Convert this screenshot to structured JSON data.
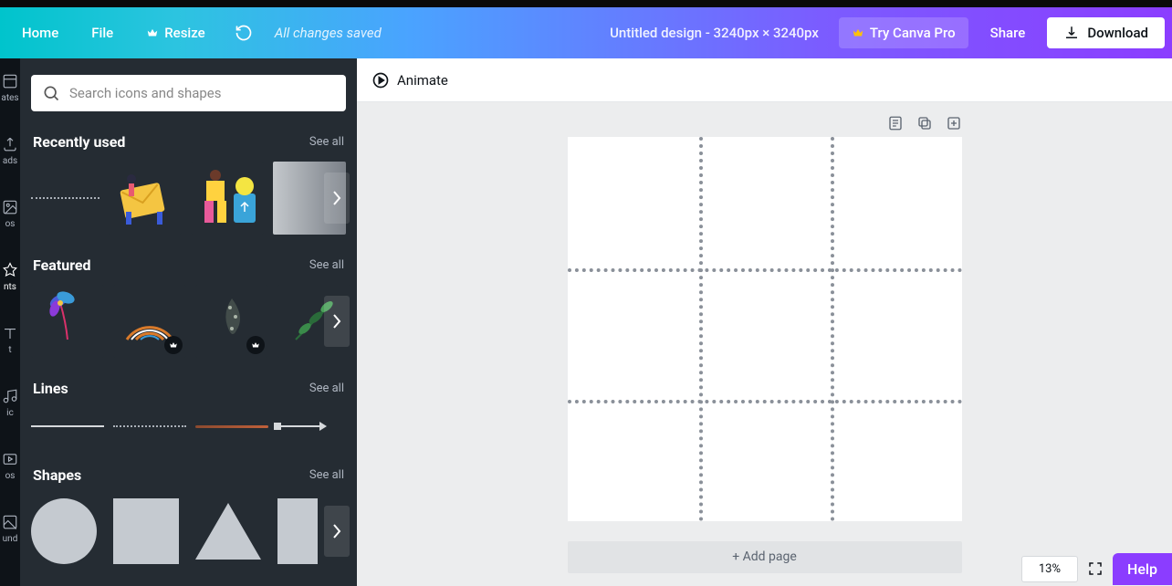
{
  "topbar": {
    "home": "Home",
    "file": "File",
    "resize": "Resize",
    "saved": "All changes saved",
    "title": "Untitled design - 3240px × 3240px",
    "try_pro": "Try Canva Pro",
    "share": "Share",
    "download": "Download"
  },
  "tabs": {
    "templates": "ates",
    "uploads": "ads",
    "photos": "os",
    "elements": "nts",
    "text": "t",
    "music": "ic",
    "videos": "os",
    "background": "und"
  },
  "search": {
    "placeholder": "Search icons and shapes"
  },
  "sections": {
    "recent": {
      "title": "Recently used",
      "see_all": "See all"
    },
    "featured": {
      "title": "Featured",
      "see_all": "See all"
    },
    "lines": {
      "title": "Lines",
      "see_all": "See all"
    },
    "shapes": {
      "title": "Shapes",
      "see_all": "See all"
    }
  },
  "canvas": {
    "animate": "Animate",
    "add_page": "+ Add page"
  },
  "footer": {
    "zoom": "13%",
    "help": "Help"
  }
}
